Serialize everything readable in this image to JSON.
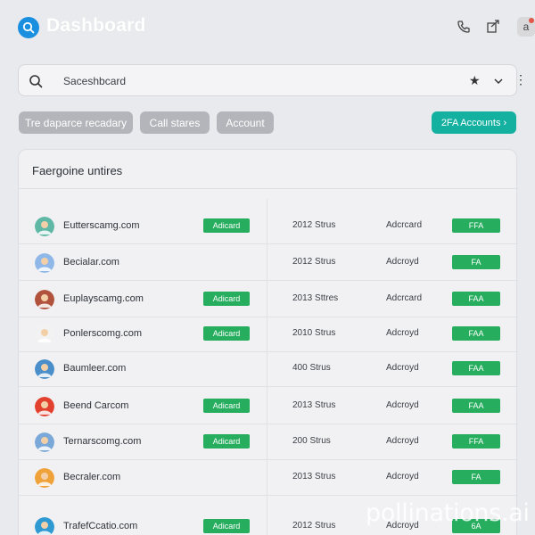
{
  "header": {
    "title": "Dashboard",
    "icons": [
      "search-icon",
      "phone-icon",
      "export-icon",
      "profile-icon"
    ],
    "avatar_label": "a"
  },
  "search": {
    "value": "Saceshbcard"
  },
  "filters": {
    "chips": [
      "Tre daparce recadary",
      "Call stares",
      "Account"
    ],
    "accent_label": "2FA Accounts ›"
  },
  "panel": {
    "title": "Faergoine untires"
  },
  "rows": [
    {
      "name": "Eutterscamg.com",
      "tag": "Adicard",
      "when": "2012 Strus",
      "acct": "Adcrcard",
      "fa": "FFA"
    },
    {
      "name": "Becialar.com",
      "tag": "",
      "when": "2012 Strus",
      "acct": "Adcroyd",
      "fa": "FA"
    },
    {
      "name": "Euplayscamg.com",
      "tag": "Adicard",
      "when": "2013 Sttres",
      "acct": "Adcrcard",
      "fa": "FAA"
    },
    {
      "name": "Ponlerscomg.com",
      "tag": "Adicard",
      "when": "2010 Strus",
      "acct": "Adcroyd",
      "fa": "FAA"
    },
    {
      "name": "Baumleer.com",
      "tag": "",
      "when": "400 Strus",
      "acct": "Adcroyd",
      "fa": "FAA"
    },
    {
      "name": "Beend Carcom",
      "tag": "Adicard",
      "when": "2013 Strus",
      "acct": "Adcroyd",
      "fa": "FAA"
    },
    {
      "name": "Ternarscomg.com",
      "tag": "Adicard",
      "when": "200 Strus",
      "acct": "Adcroyd",
      "fa": "FFA"
    },
    {
      "name": "Becraler.com",
      "tag": "",
      "when": "2013 Strus",
      "acct": "Adcroyd",
      "fa": "FA"
    },
    {
      "name": "TrafefCcatio.com",
      "tag": "Adicard",
      "when": "2012 Strus",
      "acct": "Adcroyd",
      "fa": "6A"
    }
  ],
  "avatar_colors": [
    "#5fb7a6",
    "#8fb8e8",
    "#b0523c",
    "#f2f2f2",
    "#4a8fc9",
    "#e2412f",
    "#7aa8d8",
    "#f0a23a",
    "#2f9ad1"
  ],
  "colors": {
    "brand": "#1a8fe0",
    "accent": "#14b0a0",
    "status": "#26ad5e",
    "chip": "#b3b5ba"
  },
  "watermark": "pollinations.ai"
}
